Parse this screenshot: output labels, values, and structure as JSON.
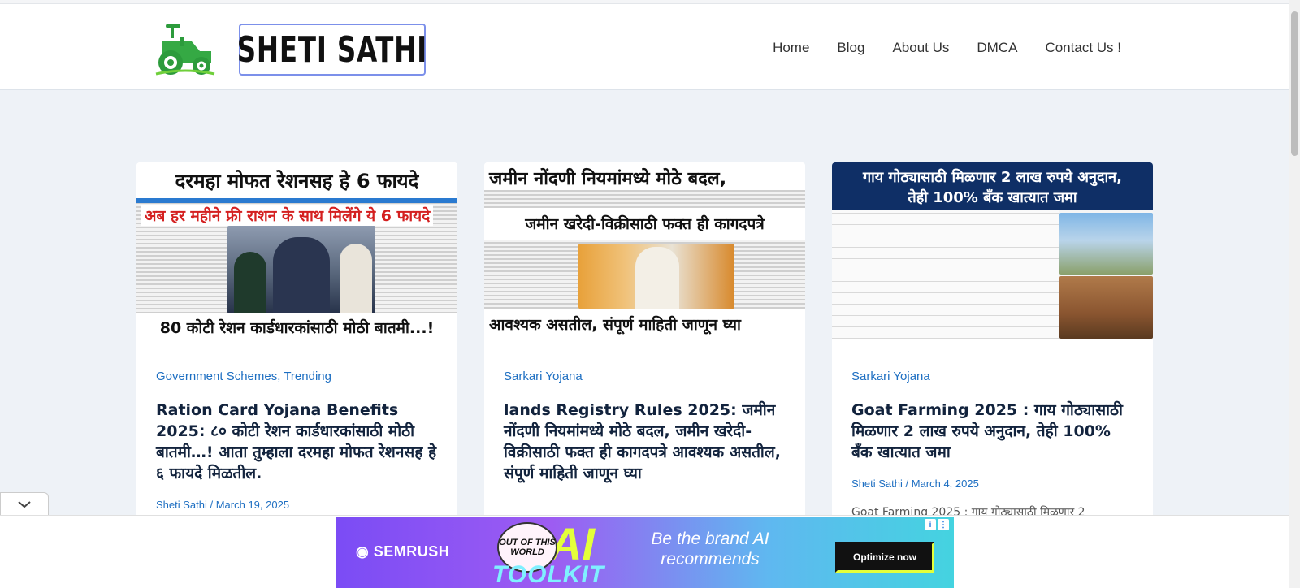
{
  "site": {
    "logo_text": "SHETI SATHI",
    "logo_icon": "tractor-icon",
    "accent_color": "#1e6fc2"
  },
  "nav": {
    "items": [
      "Home",
      "Blog",
      "About Us",
      "DMCA",
      "Contact Us !"
    ]
  },
  "cards": [
    {
      "image": {
        "top_text": "दरमहा मोफत रेशनसह हे 6 फायदे",
        "red_text": "अब हर महीने फ्री राशन के साथ मिलेंगे ये 6 फायदे",
        "bottom_text": "80 कोटी रेशन कार्डधारकांसाठी मोठी बातमी...!"
      },
      "categories": [
        "Government Schemes",
        "Trending"
      ],
      "title": "Ration Card Yojana Benefits 2025: ८० कोटी रेशन कार्डधारकांसाठी मोठी बातमी…! आता तुम्हाला दरमहा मोफत रेशनसह हे ६ फायदे मिळतील.",
      "meta": "Sheti Sathi / March 19, 2025",
      "excerpt": ""
    },
    {
      "image": {
        "top_text": "जमीन नोंदणी नियमांमध्ये मोठे बदल,",
        "mid_text": "जमीन खरेदी-विक्रीसाठी फक्त ही कागदपत्रे",
        "bottom_text": "आवश्यक असतील, संपूर्ण माहिती जाणून घ्या"
      },
      "categories": [
        "Sarkari Yojana"
      ],
      "title": "lands Registry Rules 2025: जमीन नोंदणी नियमांमध्ये मोठे बदल, जमीन खरेदी-विक्रीसाठी फक्त ही कागदपत्रे आवश्यक असतील, संपूर्ण माहिती जाणून घ्या",
      "meta": "",
      "excerpt": ""
    },
    {
      "image": {
        "top_text": "गाय गोठ्यासाठी मिळणार 2 लाख रुपये अनुदान,",
        "top_text_2": "तेही 100% बँक खात्यात जमा"
      },
      "categories": [
        "Sarkari Yojana"
      ],
      "title": "Goat Farming 2025 :  गाय गोठ्यासाठी मिळणार 2 लाख रुपये अनुदान, तेही 100% बँक खात्यात जमा",
      "meta": "Sheti Sathi / March 4, 2025",
      "excerpt": "Goat Farming 2025 : गाय गोठ्यासाठी मिळणार 2"
    }
  ],
  "ad": {
    "brand": "SEMRUSH",
    "badge": "OUT OF THIS WORLD",
    "headline_ai": "AI",
    "headline_toolkit": "TOOLKIT",
    "slogan": "Be the brand AI recommends",
    "cta": "Optimize now",
    "info_icon": "i",
    "menu_icon": "⋮"
  },
  "collapse_icon": "chevron-down-icon"
}
